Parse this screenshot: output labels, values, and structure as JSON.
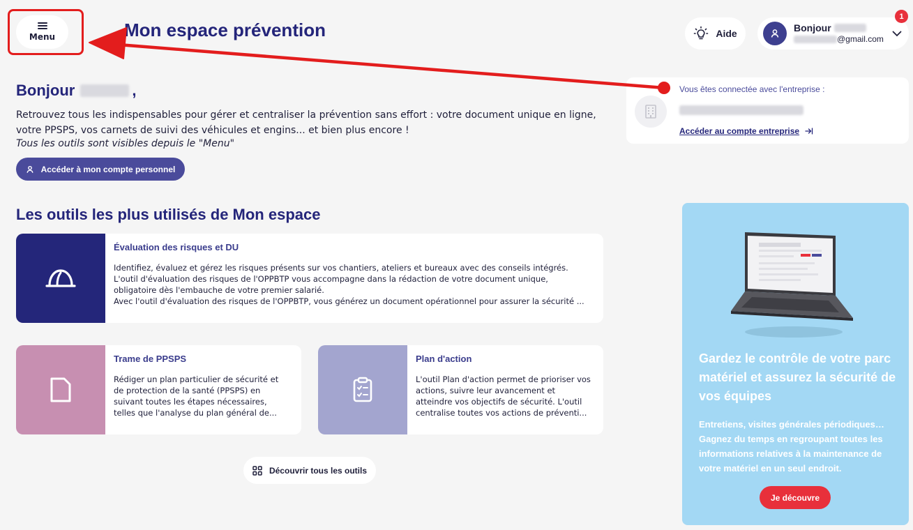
{
  "header": {
    "menu_label": "Menu",
    "title": "Mon espace prévention",
    "help_label": "Aide",
    "user_greeting": "Bonjour",
    "user_email_suffix": "@gmail.com",
    "notification_count": "1"
  },
  "greeting": {
    "hello": "Bonjour",
    "comma": ",",
    "intro_line1": "Retrouvez tous les indispensables pour gérer et centraliser la prévention sans effort : votre document unique en ligne,",
    "intro_line2": "votre PPSPS, vos carnets de suivi des véhicules et engins... et bien plus encore !",
    "note": "Tous les outils sont visibles depuis le \"Menu\"",
    "personal_account_button": "Accéder à mon compte personnel"
  },
  "company": {
    "label": "Vous êtes connectée avec l'entreprise :",
    "link": "Accéder au compte entreprise"
  },
  "tools_section": {
    "title": "Les outils les plus utilisés de Mon espace",
    "tools": [
      {
        "title": "Évaluation des risques et DU",
        "lines": [
          "Identifiez, évaluez et gérez les risques présents sur vos chantiers, ateliers et bureaux avec des conseils intégrés.",
          "L'outil d'évaluation des risques de l'OPPBTP vous accompagne dans la rédaction de votre document unique,",
          "obligatoire dès l'embauche de votre premier salarié.",
          "Avec l'outil d'évaluation des risques de l'OPPBTP, vous générez un document opérationnel pour assurer la sécurité ..."
        ]
      },
      {
        "title": "Trame de PPSPS",
        "lines": [
          "Rédiger un plan particulier de sécurité et",
          "de protection de la santé (PPSPS) en",
          "suivant toutes les étapes nécessaires,",
          "telles que l'analyse du plan général de..."
        ]
      },
      {
        "title": "Plan d'action",
        "lines": [
          "L'outil Plan d'action permet de prioriser vos",
          "actions, suivre leur avancement et",
          "atteindre vos objectifs de sécurité. L'outil",
          "centralise toutes vos actions de préventi..."
        ]
      }
    ],
    "discover_button": "Découvrir tous les outils"
  },
  "promo": {
    "title": "Gardez le contrôle de votre parc matériel et assurez la sécurité de vos équipes",
    "text": "Entretiens, visites générales périodiques… Gagnez du temps en regroupant toutes les informations relatives à la maintenance de votre matériel en un seul endroit.",
    "button": "Je découvre"
  },
  "colors": {
    "primary": "#24257a",
    "button": "#4a4b9b",
    "accent_red": "#e8303b",
    "tool1_bg": "#24267a",
    "tool2_bg": "#c78fb1",
    "tool3_bg": "#a3a5cf",
    "promo_bg": "#a3d8f4",
    "annotation_red": "#e31d1d"
  }
}
